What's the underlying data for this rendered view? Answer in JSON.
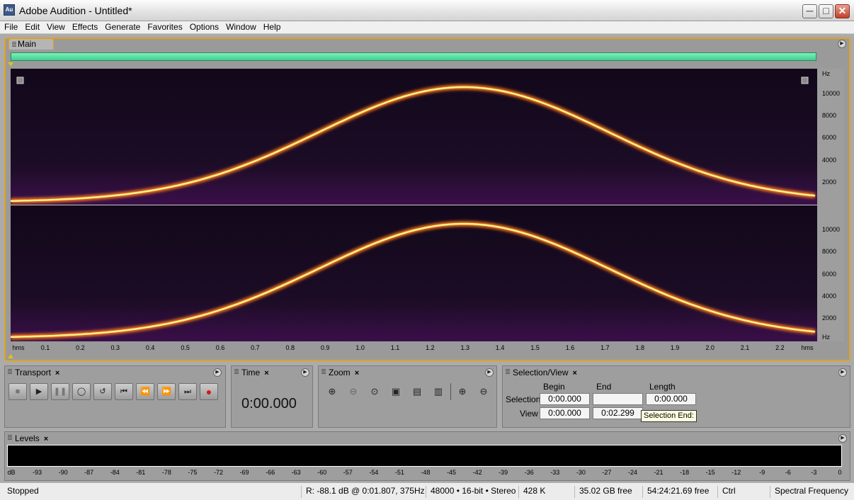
{
  "window": {
    "title": "Adobe Audition - Untitled*",
    "icon_label": "Au"
  },
  "menu": [
    "File",
    "Edit",
    "View",
    "Effects",
    "Generate",
    "Favorites",
    "Options",
    "Window",
    "Help"
  ],
  "main_panel": {
    "tab": "Main"
  },
  "freq_axis": {
    "unit": "Hz",
    "top_labels": [
      "10000",
      "8000",
      "6000",
      "4000",
      "2000"
    ],
    "bottom_labels": [
      "10000",
      "8000",
      "6000",
      "4000",
      "2000"
    ],
    "bottom_unit": "Hz"
  },
  "time_axis": {
    "unit_left": "hms",
    "unit_right": "hms",
    "labels": [
      "0.1",
      "0.2",
      "0.3",
      "0.4",
      "0.5",
      "0.6",
      "0.7",
      "0.8",
      "0.9",
      "1.0",
      "1.1",
      "1.2",
      "1.3",
      "1.4",
      "1.5",
      "1.6",
      "1.7",
      "1.8",
      "1.9",
      "2.0",
      "2.1",
      "2.2"
    ]
  },
  "transport": {
    "tab": "Transport",
    "buttons": [
      "stop",
      "play",
      "pause",
      "play-from-cursor",
      "loop",
      "go-to-start",
      "rewind",
      "fast-forward",
      "go-to-end",
      "record"
    ]
  },
  "time_panel": {
    "tab": "Time",
    "value": "0:00.000"
  },
  "zoom_panel": {
    "tab": "Zoom"
  },
  "selection_view": {
    "tab": "Selection/View",
    "headers": {
      "begin": "Begin",
      "end": "End",
      "length": "Length"
    },
    "rows": {
      "selection": {
        "label": "Selection",
        "begin": "0:00.000",
        "end": "",
        "length": "0:00.000"
      },
      "view": {
        "label": "View",
        "begin": "0:00.000",
        "end": "0:02.299"
      }
    },
    "tooltip": "Selection End:"
  },
  "levels": {
    "tab": "Levels",
    "scale": [
      "dB",
      "-93",
      "-90",
      "-87",
      "-84",
      "-81",
      "-78",
      "-75",
      "-72",
      "-69",
      "-66",
      "-63",
      "-60",
      "-57",
      "-54",
      "-51",
      "-48",
      "-45",
      "-42",
      "-39",
      "-36",
      "-33",
      "-30",
      "-27",
      "-24",
      "-21",
      "-18",
      "-15",
      "-12",
      "-9",
      "-6",
      "-3",
      "0"
    ]
  },
  "status": {
    "state": "Stopped",
    "readout": "R: -88.1 dB @  0:01.807, 375Hz",
    "format": "48000 • 16-bit • Stereo",
    "size": "428 K",
    "free_space": "35.02 GB free",
    "free_time": "54:24:21.69 free",
    "modifier": "Ctrl",
    "view_mode": "Spectral Frequency"
  },
  "colors": {
    "selection_highlight": "#e0a21e",
    "overview": "#4fdc9c",
    "spectrogram_bg": "#0c0710",
    "curve_core": "#fff28a",
    "curve_glow": "#ff7a1a"
  }
}
